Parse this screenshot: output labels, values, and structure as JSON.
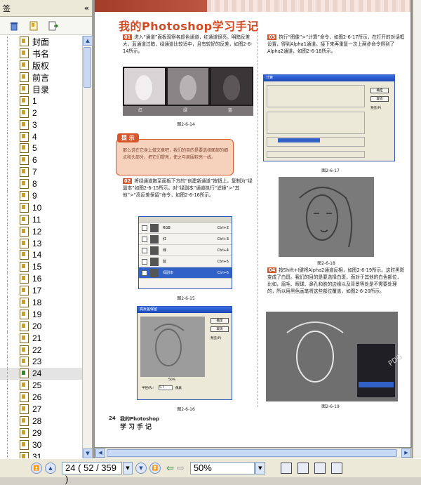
{
  "panel": {
    "title": "签",
    "collapse_icon": "«"
  },
  "bookmarks": [
    "封面",
    "书名",
    "版权",
    "前言",
    "目录",
    "1",
    "2",
    "3",
    "4",
    "5",
    "6",
    "7",
    "8",
    "9",
    "10",
    "11",
    "12",
    "13",
    "14",
    "15",
    "16",
    "17",
    "18",
    "19",
    "20",
    "21",
    "22",
    "23",
    "24",
    "25",
    "26",
    "27",
    "28",
    "29",
    "30",
    "31"
  ],
  "selected_bookmark": "24",
  "doc": {
    "chapter_title": "我的Photoshop学习手记",
    "step01_label": "01",
    "step01_text": "进入“通道”面板观察各颜色通道，红通道很亮，明暗反差大，蓝通道过暗，绿通道比较适中，且有较好的反差，如图2-6-14所示。",
    "fig14_labels": [
      "红",
      "绿",
      "蓝"
    ],
    "fig14_cap": "图2-6-14",
    "tip_label": "提 示",
    "tip_text": "那么说在它身上做文章吧，我们的目的是要选择面部的细点和头部分，把它们提亮，使之与周围较亮一线。",
    "step02_label": "02",
    "step02_text": "将绿通道拖至面板下方的“创建新通道”按钮上，复制为“绿副本”如图2-6-15所示。对“绿副本”通道执行“滤镜”>“其他”>“高反差保留”命令，如图2-6-16所示。",
    "channels": [
      {
        "name": "RGB",
        "key": "Ctrl+2"
      },
      {
        "name": "红",
        "key": "Ctrl+3"
      },
      {
        "name": "绿",
        "key": "Ctrl+4"
      },
      {
        "name": "蓝",
        "key": "Ctrl+5"
      },
      {
        "name": "绿副本",
        "key": "Ctrl+6"
      }
    ],
    "fig15_cap": "图2-6-15",
    "hp_title": "高反差保留",
    "hp_ok": "确定",
    "hp_cancel": "取消",
    "hp_preview": "预览(P)",
    "hp_zoom": "50%",
    "hp_radius_label": "半径(R):",
    "hp_radius": "5.7",
    "hp_unit": "像素",
    "fig16_cap": "图2-6-16",
    "step03_label": "03",
    "step03_text": "执行“图像”>“计算”命令，如图2-6-17所示，在打开的对话框设置，得到Alpha1通道。接下来再重复一次上两步命令得到了Alpha2通道，如图2-6-18所示。",
    "calc_title": "计算",
    "calc_ok": "确定",
    "calc_cancel": "取消",
    "calc_preview": "预览(P)",
    "fig17_cap": "图2-6-17",
    "fig18_cap": "图2-6-18",
    "step04_label": "04",
    "step04_text": "按Shift+I键将Alpha2通道反相，如图2-6-19所示。这时黑斑变成了白斑。我们的目的是要选择白斑，而对于其他的白色部位，比如，眉毛、眼球、鼻孔和脸的边缘以及背景等处是不需要处理的，所以用黑色画笔将这些部位覆盖，如图2-6-20所示。",
    "fig19_cap": "图2-6-19",
    "watermark": "PDG",
    "footer_page": "24",
    "footer_t1": "我的Photoshop",
    "footer_t2": "学习手记"
  },
  "status": {
    "page_field": "24  ( 52 / 359 )",
    "zoom": "50%"
  }
}
